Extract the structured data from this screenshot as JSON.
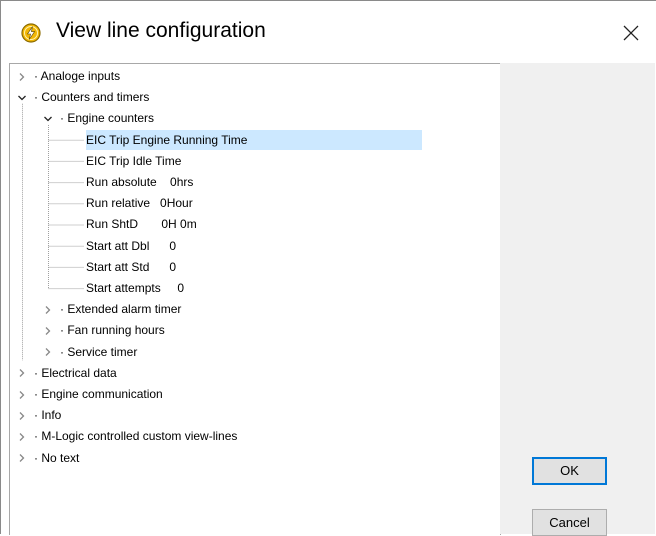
{
  "window": {
    "title": "View line configuration",
    "icon": "lightning-bolt-icon",
    "close_icon": "close-icon"
  },
  "tree": {
    "items": [
      {
        "label": "· Analoge inputs",
        "level": 0,
        "state": "collapsed"
      },
      {
        "label": "· Counters and timers",
        "level": 0,
        "state": "expanded"
      },
      {
        "label": "· Engine counters",
        "level": 1,
        "state": "expanded"
      },
      {
        "label": "EIC Trip Engine Running Time",
        "level": 2,
        "state": "leaf",
        "selected": true
      },
      {
        "label": "EIC Trip Idle Time",
        "level": 2,
        "state": "leaf"
      },
      {
        "label": "Run absolute    0hrs",
        "level": 2,
        "state": "leaf"
      },
      {
        "label": "Run relative   0Hour",
        "level": 2,
        "state": "leaf"
      },
      {
        "label": "Run ShtD       0H 0m",
        "level": 2,
        "state": "leaf"
      },
      {
        "label": "Start att Dbl      0",
        "level": 2,
        "state": "leaf"
      },
      {
        "label": "Start att Std      0",
        "level": 2,
        "state": "leaf"
      },
      {
        "label": "Start attempts     0",
        "level": 2,
        "state": "leaf"
      },
      {
        "label": "· Extended alarm timer",
        "level": 1,
        "state": "collapsed"
      },
      {
        "label": "· Fan running hours",
        "level": 1,
        "state": "collapsed"
      },
      {
        "label": "· Service timer",
        "level": 1,
        "state": "collapsed"
      },
      {
        "label": "· Electrical data",
        "level": 0,
        "state": "collapsed"
      },
      {
        "label": "· Engine communication",
        "level": 0,
        "state": "collapsed"
      },
      {
        "label": "· Info",
        "level": 0,
        "state": "collapsed"
      },
      {
        "label": "· M-Logic controlled custom view-lines",
        "level": 0,
        "state": "collapsed"
      },
      {
        "label": "· No text",
        "level": 0,
        "state": "collapsed"
      }
    ]
  },
  "buttons": {
    "ok": "OK",
    "cancel": "Cancel"
  },
  "colors": {
    "selection": "#cce8ff",
    "ok_border": "#0078d7",
    "panel": "#f0f0f0"
  }
}
